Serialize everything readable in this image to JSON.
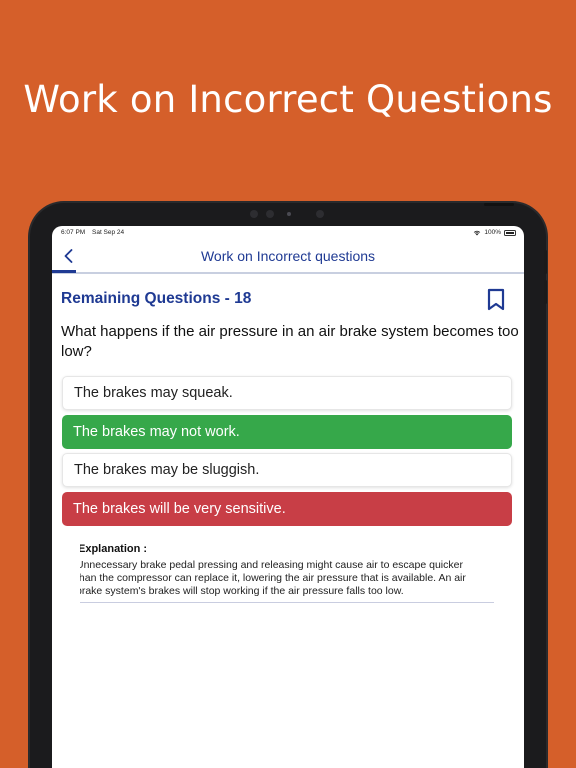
{
  "promo": {
    "headline": "Work on Incorrect Questions"
  },
  "status_bar": {
    "time": "6:07 PM",
    "date": "Sat Sep 24",
    "battery": "100%"
  },
  "nav": {
    "back_label": "<",
    "title": "Work on Incorrect questions"
  },
  "quiz": {
    "remaining_label": "Remaining Questions - 18",
    "question": "What happens if the air pressure in an air brake system becomes too low?",
    "options": [
      {
        "text": "The brakes may squeak.",
        "state": "neutral"
      },
      {
        "text": "The brakes may not work.",
        "state": "correct"
      },
      {
        "text": "The brakes may be sluggish.",
        "state": "neutral"
      },
      {
        "text": "The brakes will be very sensitive.",
        "state": "wrong"
      }
    ],
    "explanation": {
      "title": "Explanation :",
      "lines": [
        "Unnecessary brake pedal pressing and releasing might cause air to escape quicker",
        "than the compressor can replace it, lowering the air pressure that is available. An air",
        "brake system's brakes will stop working if the air pressure falls too low."
      ]
    }
  },
  "icons": {
    "back": "chevron-left-icon",
    "bookmark": "bookmark-icon",
    "wifi": "wifi-icon",
    "battery": "battery-icon"
  },
  "colors": {
    "background": "#d55f2a",
    "accent": "#1f3a93",
    "correct": "#36a84a",
    "wrong": "#c83e46"
  }
}
